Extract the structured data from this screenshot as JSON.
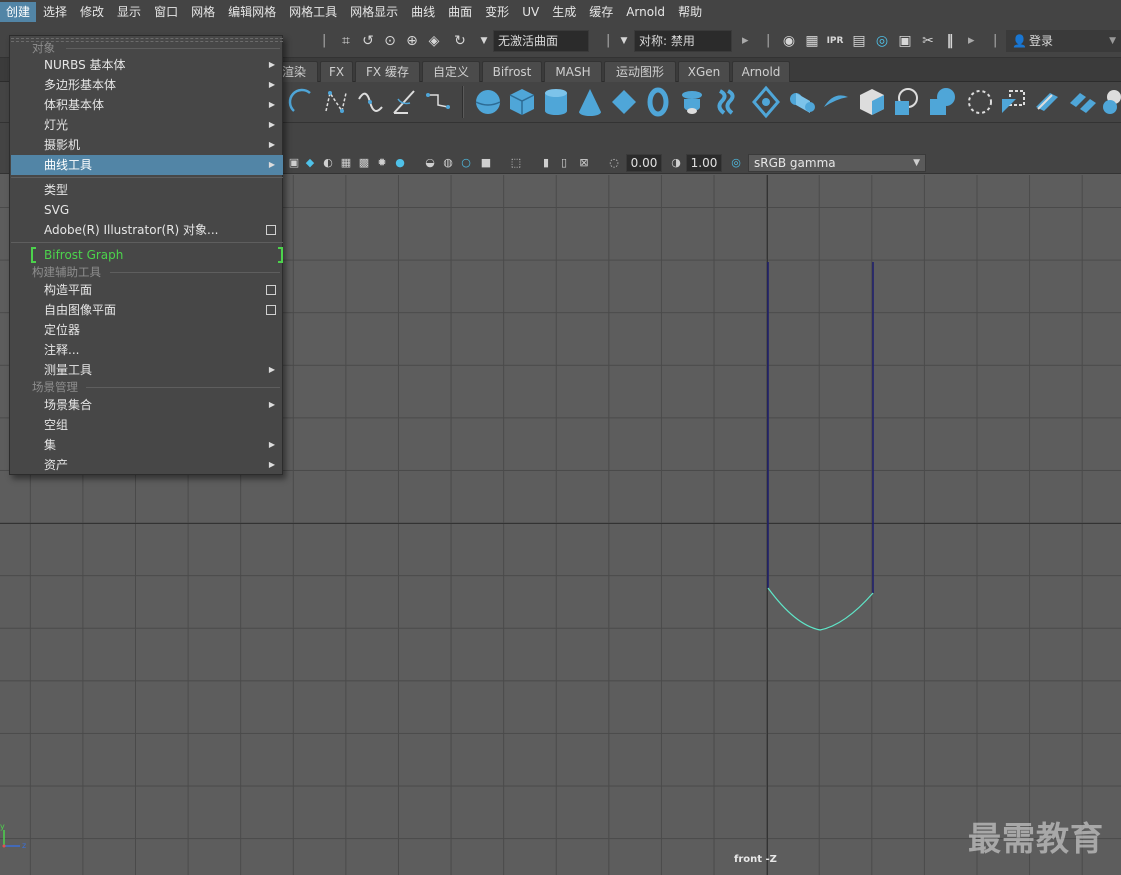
{
  "menubar": {
    "items": [
      "创建",
      "选择",
      "修改",
      "显示",
      "窗口",
      "网格",
      "编辑网格",
      "网格工具",
      "网格显示",
      "曲线",
      "曲面",
      "变形",
      "UV",
      "生成",
      "缓存",
      "Arnold",
      "帮助"
    ],
    "active_index": 0
  },
  "statusline": {
    "surface_field": "无激活曲面",
    "symmetry_field": "对称: 禁用",
    "login_label": "登录"
  },
  "shelf_tabs": [
    "渲染",
    "FX",
    "FX 缓存",
    "自定义",
    "Bifrost",
    "MASH",
    "运动图形",
    "XGen",
    "Arnold"
  ],
  "viewport_toolbar": {
    "exposure_value": "0.00",
    "gamma_value": "1.00",
    "colorspace": "sRGB gamma"
  },
  "create_menu": {
    "sections": {
      "objects": "对象",
      "construction_aids": "构建辅助工具",
      "scene_management": "场景管理"
    },
    "items": {
      "nurbs_primitives": "NURBS 基本体",
      "polygon_primitives": "多边形基本体",
      "volume_primitives": "体积基本体",
      "lights": "灯光",
      "cameras": "摄影机",
      "curve_tools": "曲线工具",
      "type": "类型",
      "svg": "SVG",
      "illustrator_objects": "Adobe(R) Illustrator(R) 对象...",
      "bifrost_graph": "Bifrost Graph",
      "construction_plane": "构造平面",
      "free_image_plane": "自由图像平面",
      "locator": "定位器",
      "annotation": "注释...",
      "measure_tools": "测量工具",
      "scene_assembly": "场景集合",
      "empty_group": "空组",
      "sets": "集",
      "assets": "资产"
    }
  },
  "viewport": {
    "camera_label": "front -Z",
    "watermark": "最需教育",
    "axis_y": "y",
    "axis_z": "z"
  },
  "colors": {
    "highlight": "#5285a6",
    "bifrost_green": "#4cd34c",
    "curve_navy": "#1d1d6e",
    "curve_cyan": "#5fe6c8",
    "shelf_icon_blue": "#4fa6d8"
  }
}
